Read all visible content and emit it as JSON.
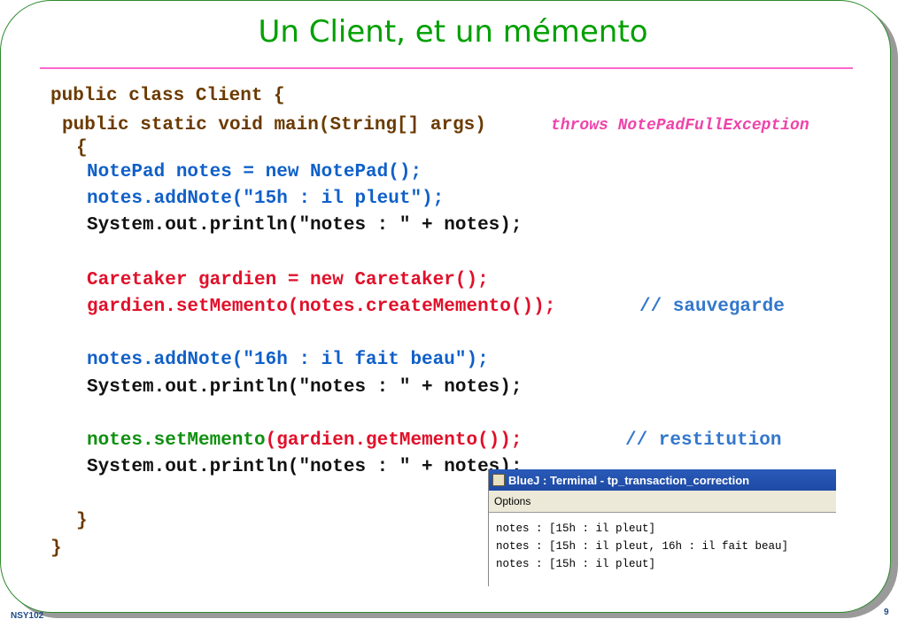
{
  "slide": {
    "title": "Un Client, et un mémento",
    "footer_left": "NSY102",
    "page_number": "9"
  },
  "code": {
    "l1": "public class Client {",
    "l2a": "public static void main(String[] args)",
    "l2b": "throws NotePadFullException",
    "l3": "{",
    "l4": "NotePad notes = new NotePad();",
    "l5": "notes.addNote(\"15h : il pleut\");",
    "l6": "System.out.println(\"notes : \" + notes);",
    "l7": "Caretaker gardien = new Caretaker();",
    "l8a": "gardien.setMemento",
    "l8b": "(notes.createMemento());",
    "l8c": "// sauvegarde",
    "l9": "notes.addNote(\"16h : il fait beau\");",
    "l10": "System.out.println(\"notes : \" + notes);",
    "l11a": "notes.setMemento",
    "l11b": "(gardien.getMemento());",
    "l11c": "// restitution",
    "l12": "System.out.println(\"notes : \" + notes);",
    "l13": "}",
    "l14": "}"
  },
  "terminal": {
    "title": "BlueJ : Terminal - tp_transaction_correction",
    "menu_options": "Options",
    "lines": [
      "notes : [15h : il pleut]",
      "notes : [15h : il pleut, 16h : il fait beau]",
      "notes : [15h : il pleut]"
    ]
  }
}
